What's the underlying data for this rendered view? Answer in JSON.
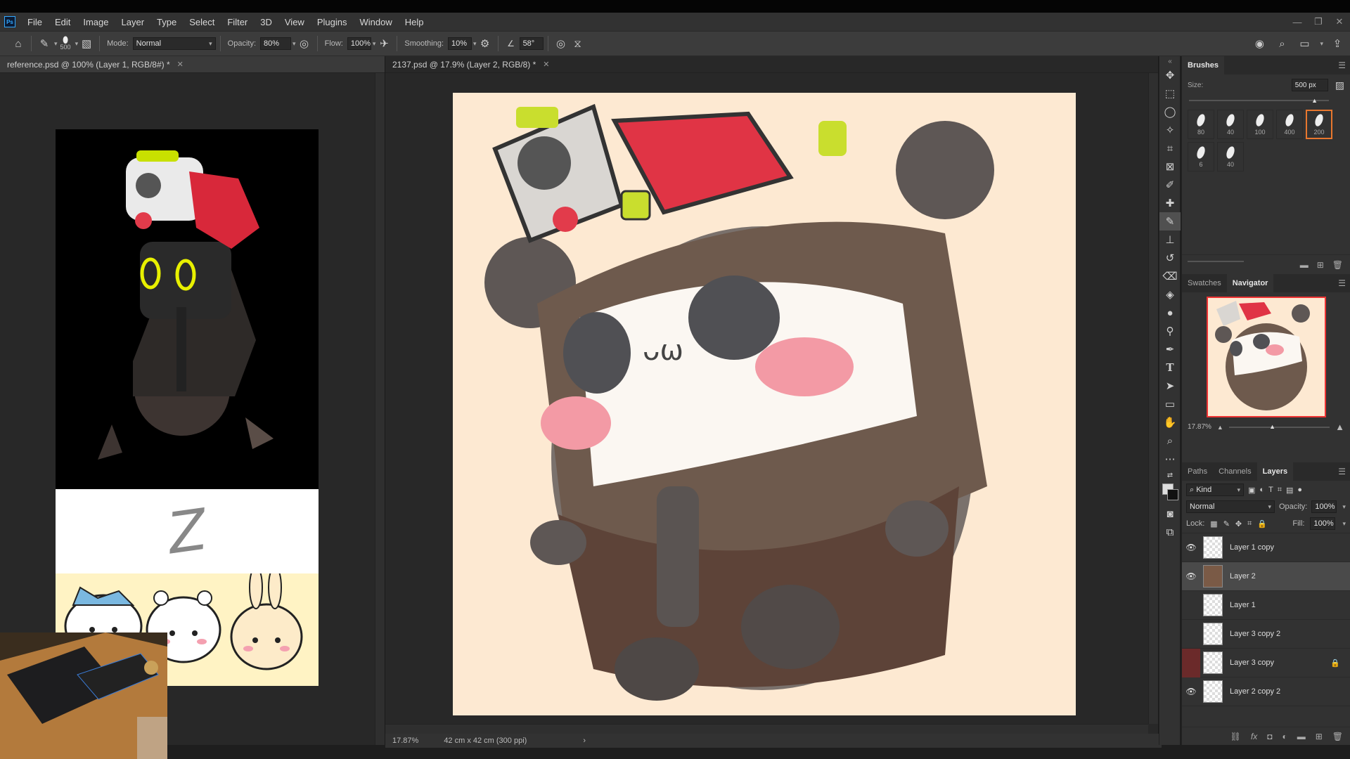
{
  "app": {
    "logo": "Ps"
  },
  "menu": [
    "File",
    "Edit",
    "Image",
    "Layer",
    "Type",
    "Select",
    "Filter",
    "3D",
    "View",
    "Plugins",
    "Window",
    "Help"
  ],
  "options": {
    "brush_size": "500",
    "mode_label": "Mode:",
    "mode_value": "Normal",
    "opacity_label": "Opacity:",
    "opacity_value": "80%",
    "flow_label": "Flow:",
    "flow_value": "100%",
    "smoothing_label": "Smoothing:",
    "smoothing_value": "10%",
    "angle_value": "58°"
  },
  "tabs": {
    "reference": "reference.psd @ 100% (Layer 1, RGB/8#) *",
    "main": "2137.psd @ 17.9% (Layer 2, RGB/8) *"
  },
  "status": {
    "zoom": "17.87%",
    "doc_size": "42 cm x 42 cm (300 ppi)"
  },
  "brushes_panel": {
    "title": "Brushes",
    "size_label": "Size:",
    "size_value": "500 px",
    "presets": [
      "80",
      "40",
      "100",
      "400",
      "200",
      "6",
      "40"
    ],
    "selected_index": 4
  },
  "navigator": {
    "tabs": [
      "Swatches",
      "Navigator"
    ],
    "zoom": "17.87%"
  },
  "layers_panel": {
    "tabs": [
      "Paths",
      "Channels",
      "Layers"
    ],
    "filter_kind": "Kind",
    "blend_mode": "Normal",
    "opacity_label": "Opacity:",
    "opacity_value": "100%",
    "lock_label": "Lock:",
    "fill_label": "Fill:",
    "fill_value": "100%",
    "layers": [
      {
        "name": "Layer 1 copy",
        "visible": true
      },
      {
        "name": "Layer 2",
        "visible": true,
        "selected": true
      },
      {
        "name": "Layer 1",
        "visible": false
      },
      {
        "name": "Layer 3 copy 2",
        "visible": false
      },
      {
        "name": "Layer 3 copy",
        "visible": false,
        "locked": true
      },
      {
        "name": "Layer 2 copy 2",
        "visible": true
      }
    ]
  },
  "reference_sketch_letter": "Z",
  "colors": {
    "canvas_bg": "#fde9d2",
    "accent_orange": "#e8772e",
    "panel_bg": "#323232"
  }
}
